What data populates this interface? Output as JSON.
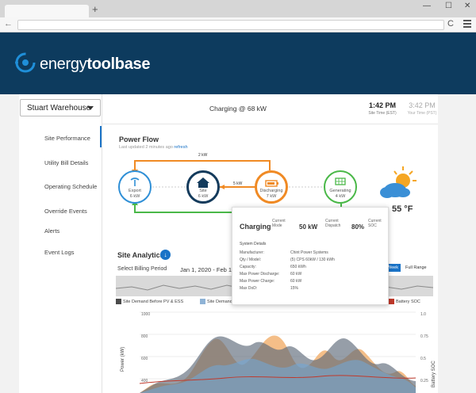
{
  "browser": {
    "new_tab": "+",
    "window_controls": [
      "—",
      "☐",
      "✕"
    ],
    "back": "←",
    "reload": "C"
  },
  "brand": {
    "name_light": "energy",
    "name_bold": "toolbase"
  },
  "site_select": {
    "value": "Stuart Warehouse"
  },
  "sidebar": {
    "items": [
      {
        "label": "Site Performance",
        "active": true
      },
      {
        "label": "Utility Bill Details"
      },
      {
        "label": "Operating Schedule"
      },
      {
        "label": "Override Events"
      },
      {
        "label": "Alerts"
      },
      {
        "label": "Event Logs"
      }
    ]
  },
  "header": {
    "status": "Charging @ 68 kW",
    "site_time": "1:42 PM",
    "site_time_label": "Site Time (EST)",
    "user_time": "3:42 PM",
    "user_time_label": "Your Time (PST)"
  },
  "power_flow": {
    "title": "Power Flow",
    "updated": "Last updated 2 minutes ago",
    "refresh": "refresh",
    "nodes": [
      {
        "label": "Export",
        "value": "6 kW",
        "icon": "antenna-icon",
        "color": "#2f8fd6"
      },
      {
        "label": "Site",
        "value": "6 kW",
        "icon": "home-icon",
        "color": "#143b5c"
      },
      {
        "label": "Discharging",
        "value": "7 kW",
        "icon": "battery-icon",
        "color": "#f08a24"
      },
      {
        "label": "Generating",
        "value": "4 kW",
        "icon": "solar-panel-icon",
        "color": "#4ab848"
      }
    ],
    "flow_top": "2 kW",
    "flow_mid": "5 kW",
    "temperature": "55 °F",
    "weather_icon": "partly-sunny-icon"
  },
  "popup": {
    "mode": "Charging",
    "mode_label": "Current Mode",
    "dispatch": "50 kW",
    "dispatch_label": "Current Dispatch",
    "soc": "80%",
    "soc_label": "Current SOC",
    "section": "System Details",
    "rows": [
      {
        "k": "Manufacturer:",
        "v": "Chint Power Systems"
      },
      {
        "k": "Qty / Model:",
        "v": "(5) CPS 60kW / 130 kWh"
      },
      {
        "k": "Capacity:",
        "v": "650 kWh"
      },
      {
        "k": "Max Power Discharge:",
        "v": "60 kW"
      },
      {
        "k": "Max Power Charge:",
        "v": "60 kW"
      },
      {
        "k": "Max DoD:",
        "v": "15%"
      }
    ]
  },
  "analytics": {
    "title": "Site Analytics",
    "billing_label": "Select Billing Period",
    "billing_range": "Jan 1, 2020 - Feb 1, 2020",
    "range_options": [
      "Week",
      "Full Range"
    ],
    "legend": [
      {
        "label": "Site Demand Before PV & ESS",
        "color": "#4a4a4a"
      },
      {
        "label": "Site Demand A",
        "color": "#8fb3d6"
      },
      {
        "label": "Battery SOC",
        "color": "#c0392b"
      }
    ],
    "y_left_label": "Power (kW)",
    "y_right_label": "Battery SOC",
    "y_left_ticks": [
      "1000",
      "800",
      "600",
      "400"
    ],
    "y_right_ticks": [
      "1.0",
      "0.75",
      "0.5",
      "0.25"
    ]
  }
}
